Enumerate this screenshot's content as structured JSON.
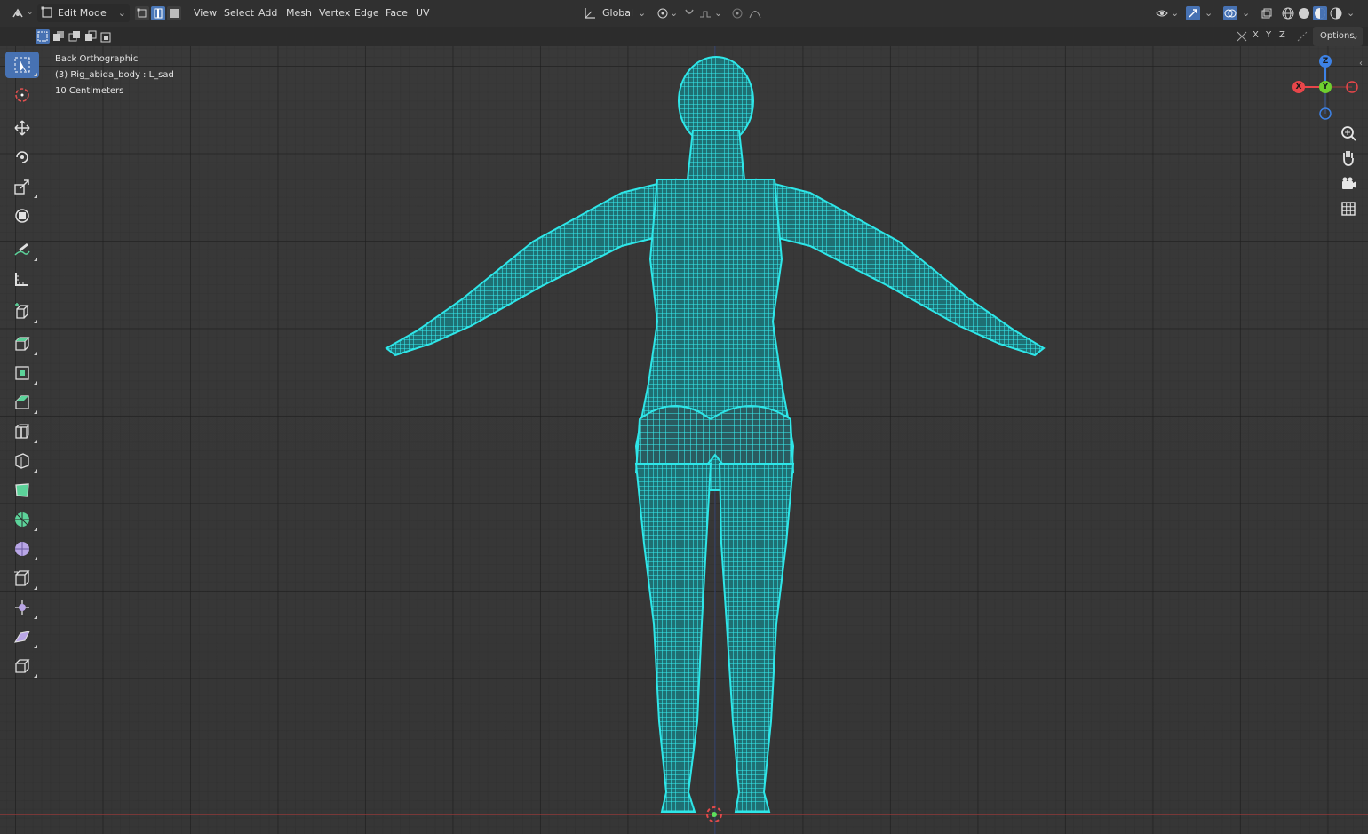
{
  "header": {
    "mode_label": "Edit Mode",
    "menus": [
      "View",
      "Select",
      "Add",
      "Mesh",
      "Vertex",
      "Edge",
      "Face",
      "UV"
    ],
    "orientation_label": "Global",
    "options_label": "Options"
  },
  "subheader": {
    "axes": [
      "X",
      "Y",
      "Z"
    ]
  },
  "overlay": {
    "view_name": "Back Orthographic",
    "object_info": "(3) Rig_abida_body : L_sad",
    "scale_info": "10 Centimeters"
  },
  "gizmo": {
    "z_label": "Z",
    "y_label": "Y",
    "x_label": "X",
    "colors": {
      "x": "#e8464a",
      "y": "#6fcf2f",
      "z": "#3d82e6"
    }
  },
  "toolbar": {
    "tools": [
      "select-box-tool",
      "cursor-tool",
      "move-tool",
      "rotate-tool",
      "scale-tool",
      "transform-tool",
      "annotate-tool",
      "measure-tool",
      "add-cube-tool",
      "extrude-region-tool",
      "inset-faces-tool",
      "bevel-tool",
      "loop-cut-tool",
      "knife-tool",
      "poly-build-tool",
      "spin-tool",
      "smooth-tool",
      "edge-slide-tool",
      "shrink-fatten-tool",
      "shear-tool",
      "rip-region-tool"
    ]
  },
  "colors": {
    "mesh": "#2ee6e8",
    "accent": "#4772b3",
    "x_axis_line": "#a03a3a"
  }
}
